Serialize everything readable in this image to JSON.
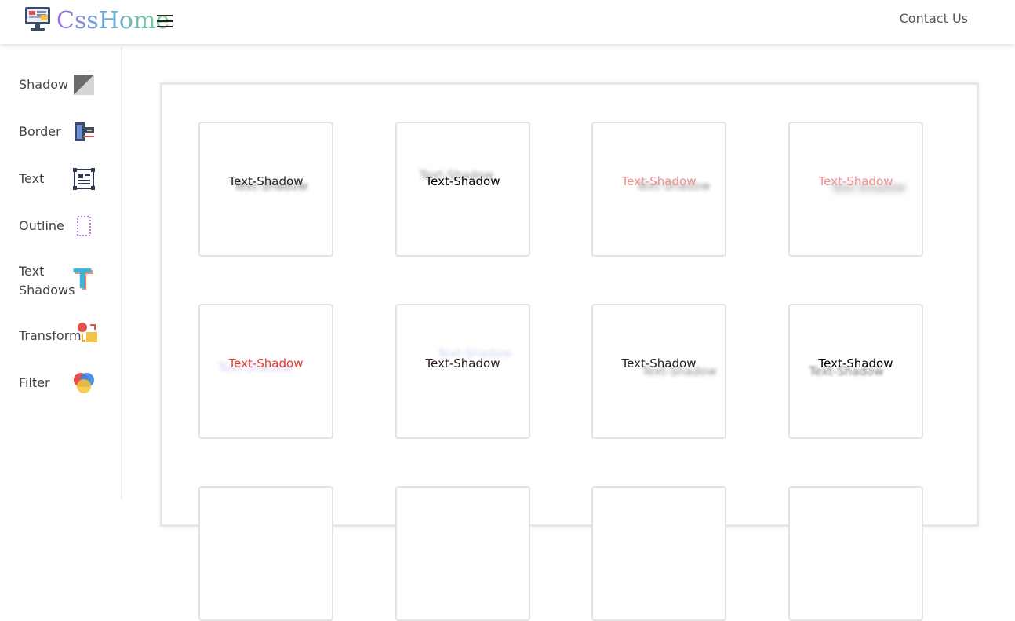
{
  "header": {
    "brand": "CssHome",
    "contact_label": "Contact Us"
  },
  "sidebar": {
    "items": [
      {
        "label": "Shadow",
        "icon": "shadow-icon"
      },
      {
        "label": "Border",
        "icon": "border-icon"
      },
      {
        "label": "Text",
        "icon": "text-icon"
      },
      {
        "label": "Outline",
        "icon": "outline-icon"
      },
      {
        "label": "Text Shadows",
        "icon": "text-shadows-icon"
      },
      {
        "label": "Transform",
        "icon": "transform-icon"
      },
      {
        "label": "Filter",
        "icon": "filter-icon"
      }
    ]
  },
  "main": {
    "cards": [
      {
        "text": "Text-Shadow"
      },
      {
        "text": "Text-Shadow"
      },
      {
        "text": "Text-Shadow"
      },
      {
        "text": "Text-Shadow"
      },
      {
        "text": "Text-Shadow"
      },
      {
        "text": "Text-Shadow"
      },
      {
        "text": "Text-Shadow"
      },
      {
        "text": "Text-Shadow"
      }
    ]
  },
  "colors": {
    "brand_gradient": [
      "#9b6dd6",
      "#6aa6de",
      "#7ad08a"
    ],
    "sidebar_text": "#444444",
    "card_border": "#e3e3e3",
    "demo_pink": "#ee8f8f",
    "demo_red": "#e03a2e"
  }
}
